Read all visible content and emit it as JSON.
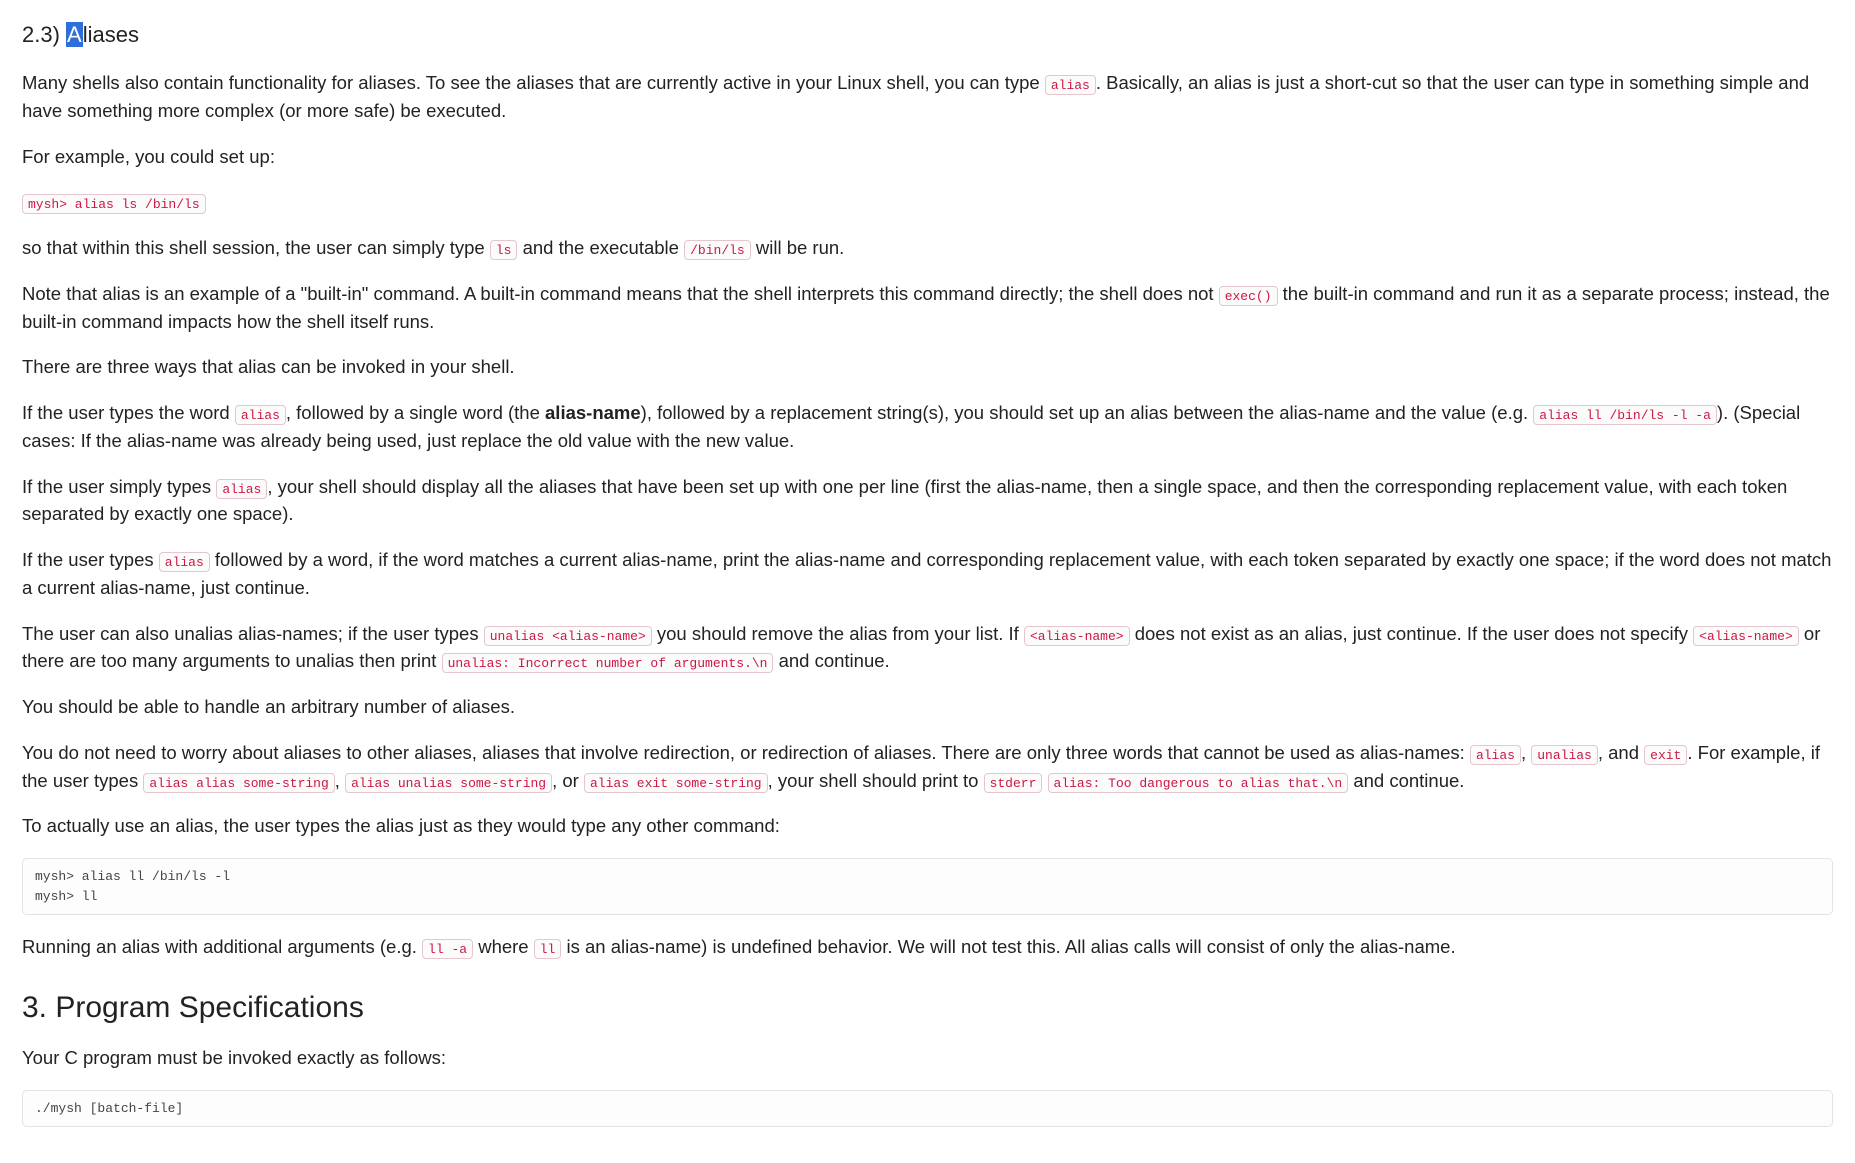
{
  "section": {
    "number": "2.3)",
    "hl": "A",
    "rest": "liases"
  },
  "p1_a": "Many shells also contain functionality for aliases.   To see the aliases that are currently active in your Linux shell, you can type ",
  "c1": "alias",
  "p1_b": ".   Basically, an alias is just a short-cut so that the user can type in something simple and have something more complex (or more safe) be executed.",
  "p2": "For example, you could set up:",
  "code1": "mysh> alias ls /bin/ls",
  "p3_a": "so that within this shell session, the user can simply type ",
  "c3a": "ls",
  "p3_b": " and the executable ",
  "c3b": "/bin/ls",
  "p3_c": " will be run.",
  "p4_a": "Note that alias is an example of a \"built-in\" command. A built-in command means that the shell interprets this command directly; the shell does not ",
  "c4": "exec()",
  "p4_b": " the built-in command and run it as a separate process; instead, the built-in command impacts how the shell itself runs.",
  "p5": "There are three ways that alias can be invoked in your shell.",
  "p6_a": "If the user types the word ",
  "c6a": "alias",
  "p6_b": ", followed by a single word (the ",
  "p6_strong": "alias-name",
  "p6_c": "), followed by a replacement string(s), you should set up an alias between the alias-name and the value (e.g. ",
  "c6b": "alias ll /bin/ls -l -a",
  "p6_d": "). (Special cases: If the alias-name was already being used, just replace the old value with the new value.",
  "p7_a": "If the user simply types ",
  "c7": "alias",
  "p7_b": ", your shell should display all the aliases that have been set up with one per line (first the alias-name, then a single space, and then the corresponding replacement value, with each token separated by exactly one space).",
  "p8_a": "If the user types ",
  "c8": "alias",
  "p8_b": " followed by a word, if the word matches a current alias-name, print the alias-name and corresponding replacement value, with each token separated by exactly one space; if the word does not match a current alias-name, just continue.",
  "p9_a": "The user can also unalias alias-names; if the user types ",
  "c9a": "unalias <alias-name>",
  "p9_b": " you should remove the alias from your list. If ",
  "c9b": "<alias-name>",
  "p9_c": " does not exist as an alias, just continue. If the user does not specify ",
  "c9c": "<alias-name>",
  "p9_d": " or there are too many arguments to unalias then print ",
  "c9d": "unalias: Incorrect number of arguments.\\n",
  "p9_e": " and continue.",
  "p10": "You should be able to handle an arbitrary number of aliases.",
  "p11_a": "You do not need to worry about aliases to other aliases, aliases that involve redirection, or redirection of aliases. There are only three words that cannot be used as alias-names: ",
  "c11a": "alias",
  "p11_b": ", ",
  "c11b": "unalias",
  "p11_c": ", and ",
  "c11c": "exit",
  "p11_d": ". For example, if the user types ",
  "c11d": "alias alias some-string",
  "p11_e": ", ",
  "c11e": "alias unalias some-string",
  "p11_f": ", or ",
  "c11f": "alias exit some-string",
  "p11_g": ", your shell should print to ",
  "c11g": "stderr",
  "p11_h": " ",
  "c11h": "alias: Too dangerous to alias that.\\n",
  "p11_i": " and continue.",
  "p12": "To actually use an alias, the user types the alias just as they would type any other command:",
  "code2": "mysh> alias ll /bin/ls -l\nmysh> ll",
  "p13_a": "Running an alias with additional arguments (e.g. ",
  "c13a": "ll -a",
  "p13_b": " where ",
  "c13b": "ll",
  "p13_c": " is an alias-name) is undefined behavior. We will not test this. All alias calls will consist of only the alias-name.",
  "h2": "3. Program Specifications",
  "p14": "Your C program must be invoked exactly as follows:",
  "code3": "./mysh [batch-file]"
}
